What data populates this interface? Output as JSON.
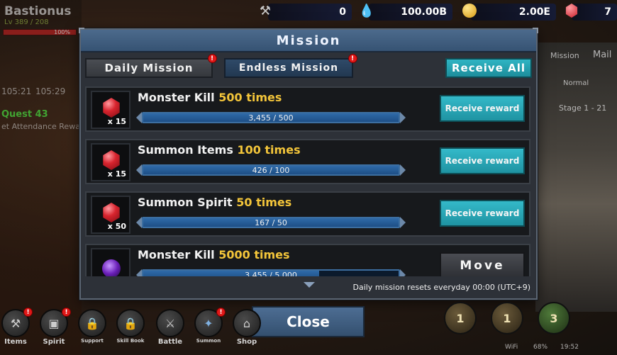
{
  "hud": {
    "player_name": "Bastionus",
    "level_text": "Lv 389 / 208",
    "hp_percent": "100%",
    "hp_fill": 1.0
  },
  "resources": [
    {
      "icon": "pickaxe-icon",
      "value": "0"
    },
    {
      "icon": "blue-drop-icon",
      "value": "100.00B"
    },
    {
      "icon": "gold-coin-icon",
      "value": "2.00E"
    },
    {
      "icon": "red-gem-icon",
      "value": "7"
    }
  ],
  "modal": {
    "title": "Mission",
    "tabs": [
      {
        "label": "Daily Mission",
        "badge": "!"
      },
      {
        "label": "Endless Mission",
        "badge": "!"
      }
    ],
    "receive_all_label": "Receive All",
    "missions": [
      {
        "name": "Monster Kill",
        "target": "500 times",
        "reward_qty": "x 15",
        "reward_icon": "red-gem-icon",
        "progress_text": "3,455 / 500",
        "progress": 1.0,
        "button": "Receive reward"
      },
      {
        "name": "Summon Items",
        "target": "100 times",
        "reward_qty": "x 15",
        "reward_icon": "red-gem-icon",
        "progress_text": "426 / 100",
        "progress": 1.0,
        "button": "Receive reward"
      },
      {
        "name": "Summon Spirit",
        "target": "50 times",
        "reward_qty": "x 50",
        "reward_icon": "red-gem-icon",
        "progress_text": "167 / 50",
        "progress": 1.0,
        "button": "Receive reward"
      },
      {
        "name": "Monster Kill",
        "target": "5000 times",
        "reward_qty": "",
        "reward_icon": "purple-orb-icon",
        "progress_text": "3,455 / 5,000",
        "progress": 0.69,
        "button": "Move"
      }
    ],
    "reset_note": "Daily mission resets everyday 00:00 (UTC+9)",
    "close_label": "Close"
  },
  "side_left": {
    "time_1": "105:21",
    "time_2": "105:29",
    "quest": "Quest 43",
    "quest_desc": "et Attendance Rewa"
  },
  "side_right": {
    "mission_label": "Mission",
    "mail_label": "Mail",
    "mode": "Normal",
    "stage": "Stage 1 - 21"
  },
  "nav": [
    {
      "label": "Items",
      "icon": "hammer-icon",
      "badge": "!"
    },
    {
      "label": "Spirit",
      "icon": "spirit-icon",
      "badge": "!"
    },
    {
      "label": "Support",
      "icon": "lock-icon",
      "badge": ""
    },
    {
      "label": "Skill Book",
      "icon": "lock-icon",
      "badge": ""
    },
    {
      "label": "Battle",
      "icon": "crossed-swords-icon",
      "badge": ""
    },
    {
      "label": "Summon",
      "icon": "summon-icon",
      "badge": "!"
    },
    {
      "label": "Shop",
      "icon": "shop-icon",
      "badge": ""
    }
  ],
  "skills": [
    "1",
    "1",
    "3"
  ],
  "status_bar": {
    "wifi": "WiFi",
    "battery": "68%",
    "time": "19:52"
  },
  "colors": {
    "accent_teal": "#1f93a2",
    "title_blue": "#365373",
    "highlight_gold": "#f3c53a"
  }
}
